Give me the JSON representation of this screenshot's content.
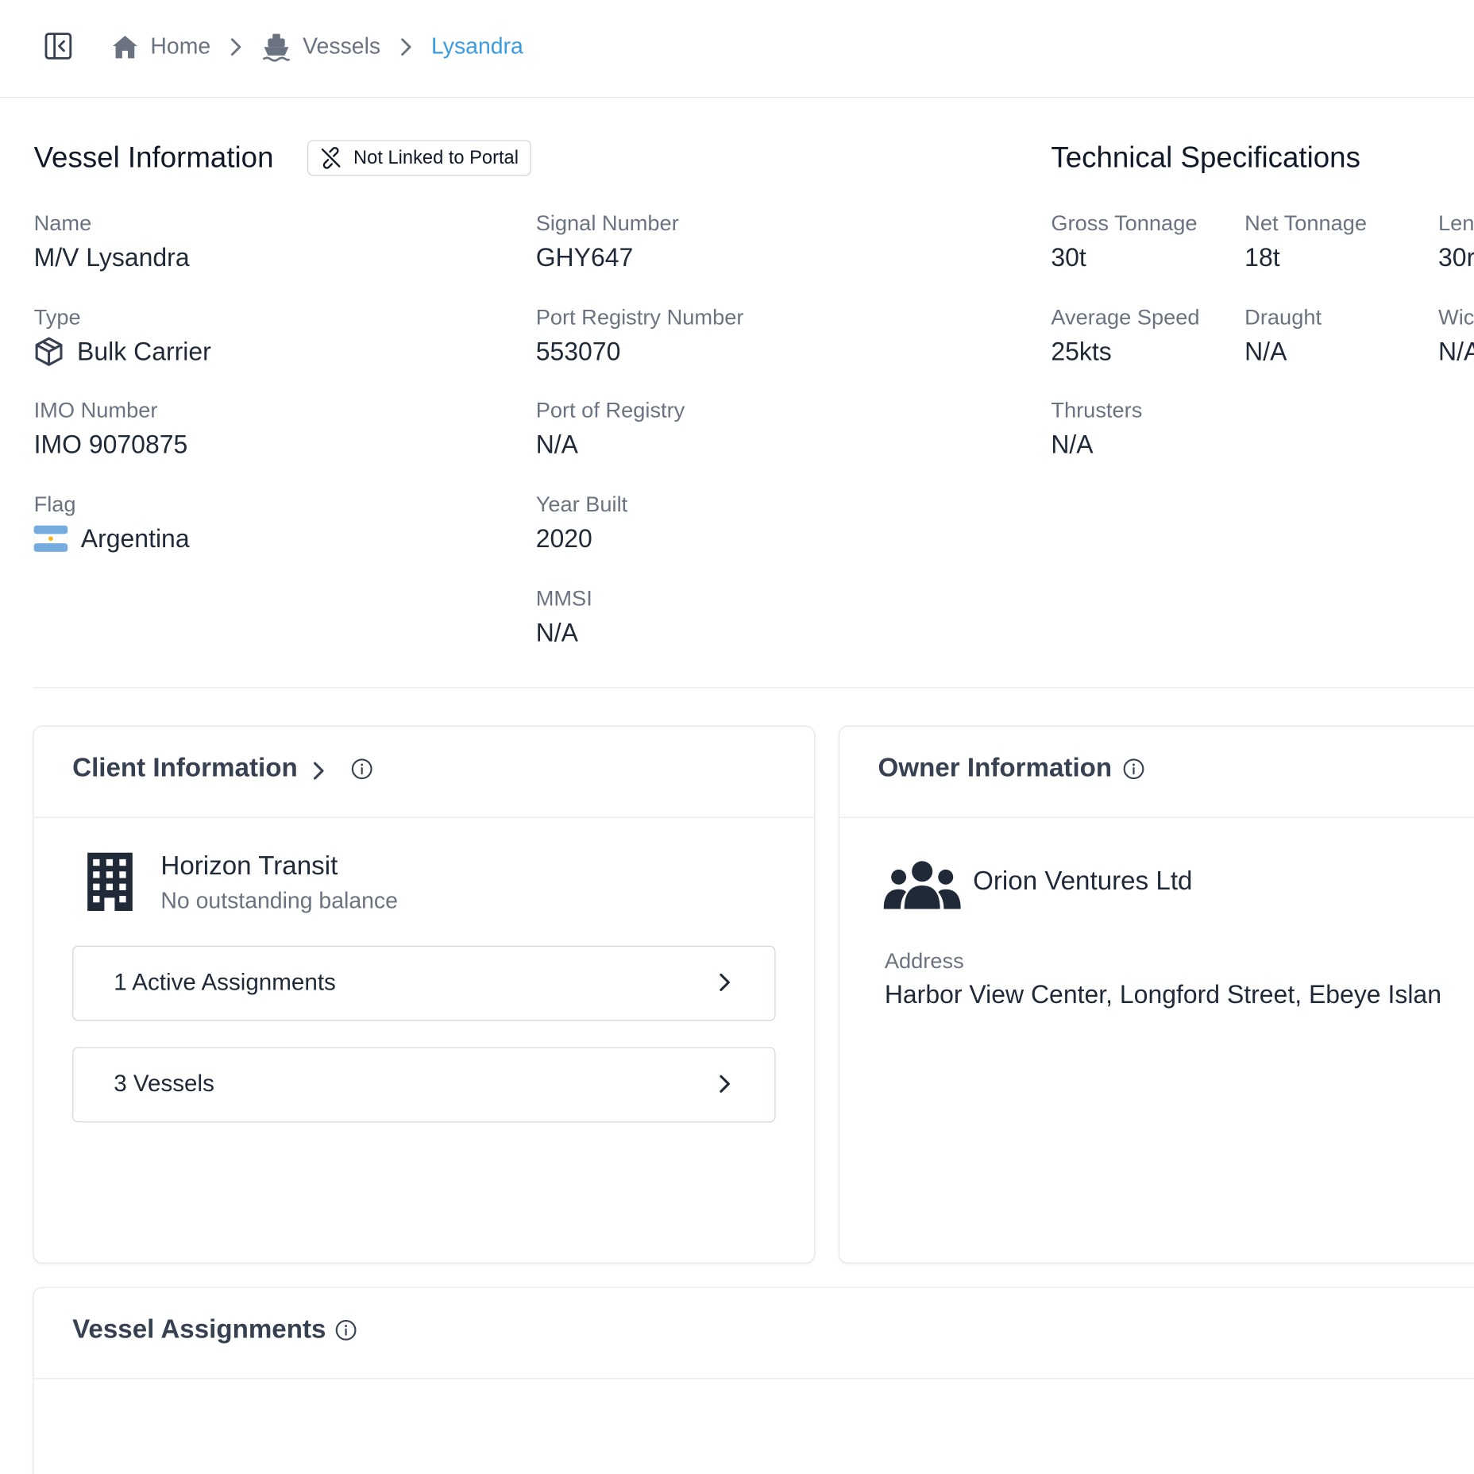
{
  "breadcrumb": {
    "home": "Home",
    "vessels": "Vessels",
    "current": "Lysandra"
  },
  "vessel_info": {
    "title": "Vessel Information",
    "portal_badge": "Not Linked to Portal",
    "name_label": "Name",
    "name_value": "M/V Lysandra",
    "type_label": "Type",
    "type_value": "Bulk Carrier",
    "imo_label": "IMO Number",
    "imo_value": "IMO 9070875",
    "flag_label": "Flag",
    "flag_value": "Argentina",
    "signal_label": "Signal Number",
    "signal_value": "GHY647",
    "port_reg_num_label": "Port Registry Number",
    "port_reg_num_value": "553070",
    "port_registry_label": "Port of Registry",
    "port_registry_value": "N/A",
    "year_built_label": "Year Built",
    "year_built_value": "2020",
    "mmsi_label": "MMSI",
    "mmsi_value": "N/A"
  },
  "tech_specs": {
    "title": "Technical Specifications",
    "gross_label": "Gross Tonnage",
    "gross_value": "30t",
    "net_label": "Net Tonnage",
    "net_value": "18t",
    "length_label": "Len",
    "length_value": "30r",
    "speed_label": "Average Speed",
    "speed_value": "25kts",
    "draught_label": "Draught",
    "draught_value": "N/A",
    "width_label": "Wic",
    "width_value": "N/A",
    "thrusters_label": "Thrusters",
    "thrusters_value": "N/A"
  },
  "client": {
    "title": "Client Information",
    "company_name": "Horizon Transit",
    "balance_status": "No outstanding balance",
    "assignments_button": "1 Active Assignments",
    "vessels_button": "3 Vessels"
  },
  "owner": {
    "title": "Owner Information",
    "company_name": "Orion Ventures Ltd",
    "address_label": "Address",
    "address_value": "Harbor View Center, Longford Street, Ebeye Islan"
  },
  "assignments": {
    "title": "Vessel Assignments"
  },
  "colors": {
    "accent": "#3b9be0",
    "text_primary": "#1f2937",
    "text_muted": "#6b7280",
    "border": "#e5e7eb"
  }
}
